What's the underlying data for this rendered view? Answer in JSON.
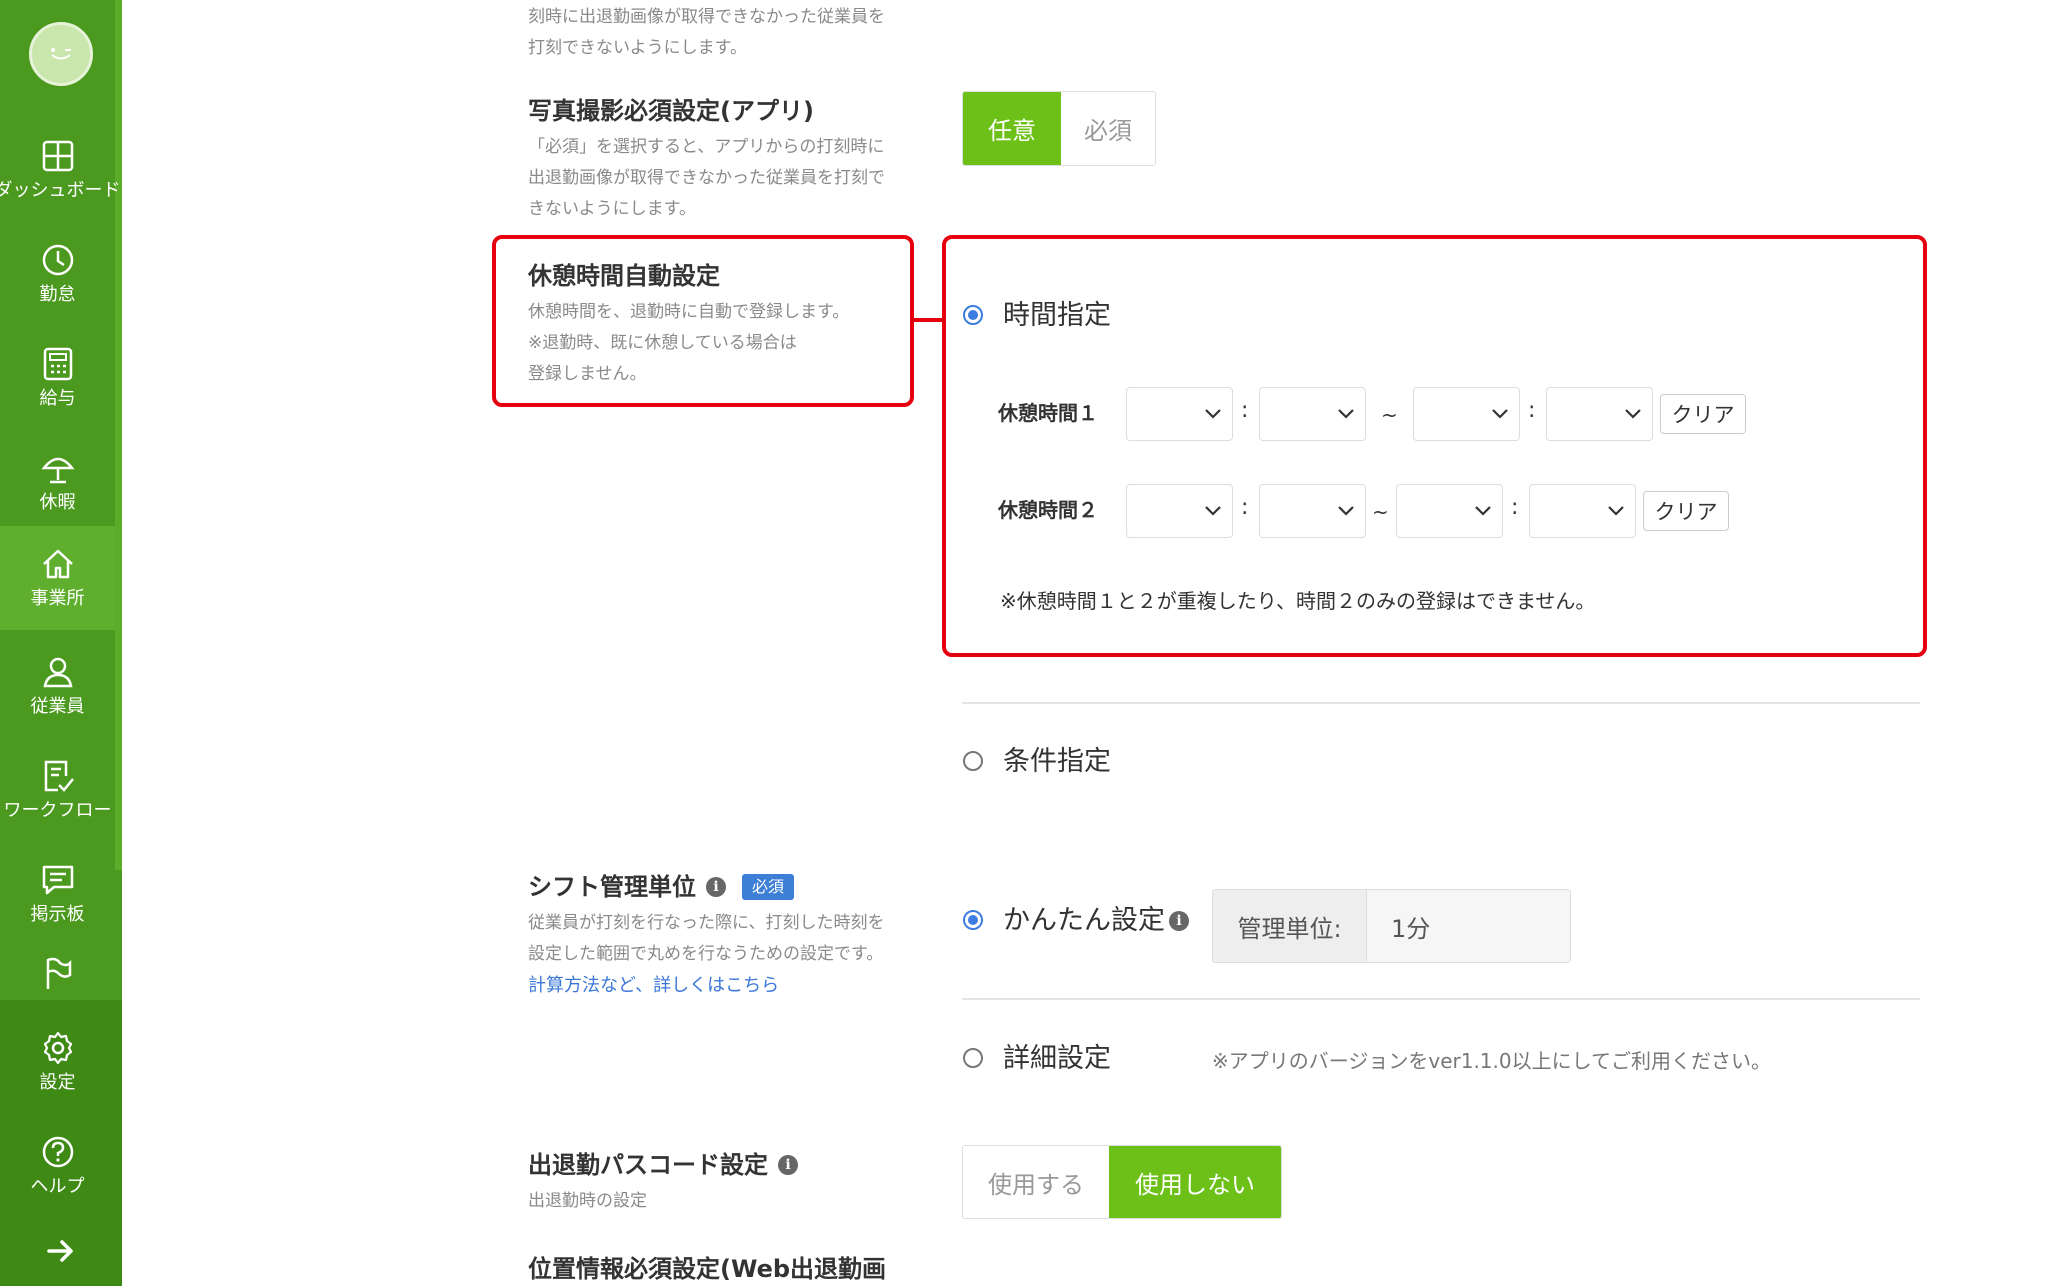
{
  "sidebar": {
    "items": [
      {
        "label": "ダッシュボード",
        "icon": "dashboard-icon"
      },
      {
        "label": "勤怠",
        "icon": "clock-icon"
      },
      {
        "label": "給与",
        "icon": "calculator-icon"
      },
      {
        "label": "休暇",
        "icon": "umbrella-icon"
      },
      {
        "label": "事業所",
        "icon": "home-icon",
        "active": true
      },
      {
        "label": "従業員",
        "icon": "person-icon"
      },
      {
        "label": "ワークフロー",
        "icon": "checklist-icon"
      },
      {
        "label": "掲示板",
        "icon": "message-icon"
      },
      {
        "label": "",
        "icon": "flag-icon"
      },
      {
        "label": "設定",
        "icon": "gear-icon"
      },
      {
        "label": "ヘルプ",
        "icon": "help-icon"
      }
    ],
    "expand_icon": "arrow-right-icon"
  },
  "colors": {
    "sidebar": "#4b9a1f",
    "sidebar_active": "#5fae2d",
    "toggle_on": "#6cc018",
    "highlight": "#e6000f",
    "radio": "#3b7de0",
    "badge": "#3d7fd6"
  },
  "top_desc": {
    "line1": "刻時に出退勤画像が取得できなかった従業員を",
    "line2": "打刻できないようにします。"
  },
  "photo_setting": {
    "title": "写真撮影必須設定(アプリ)",
    "desc_line1": "「必須」を選択すると、アプリからの打刻時に",
    "desc_line2": "出退勤画像が取得できなかった従業員を打刻で",
    "desc_line3": "きないようにします。",
    "options": [
      "任意",
      "必須"
    ],
    "selected": "任意"
  },
  "break_setting": {
    "title": "休憩時間自動設定",
    "desc_line1": "休憩時間を、退勤時に自動で登録します。",
    "desc_line2": "※退勤時、既に休憩している場合は",
    "desc_line3": "登録しません。",
    "mode_time": "時間指定",
    "mode_condition": "条件指定",
    "selected_mode": "時間指定",
    "break1_label": "休憩時間１",
    "break2_label": "休憩時間２",
    "colon": ":",
    "tilde": "~",
    "clear_label": "クリア",
    "note": "※休憩時間１と２が重複したり、時間２のみの登録はできません。"
  },
  "shift_setting": {
    "title": "シフト管理単位",
    "required_badge": "必須",
    "desc_line1": "従業員が打刻を行なった際に、打刻した時刻を",
    "desc_line2": "設定した範囲で丸めを行なうための設定です。",
    "link": "計算方法など、詳しくはこちら",
    "mode_simple": "かんたん設定",
    "mode_detail": "詳細設定",
    "selected_mode": "かんたん設定",
    "unit_label": "管理単位:",
    "unit_value": "1分",
    "detail_note": "※アプリのバージョンをver1.1.0以上にしてご利用ください。"
  },
  "passcode_setting": {
    "title": "出退勤パスコード設定",
    "desc": "出退勤時の設定",
    "options": [
      "使用する",
      "使用しない"
    ],
    "selected": "使用しない"
  },
  "location_setting": {
    "title": "位置情報必須設定(Web出退勤画"
  }
}
